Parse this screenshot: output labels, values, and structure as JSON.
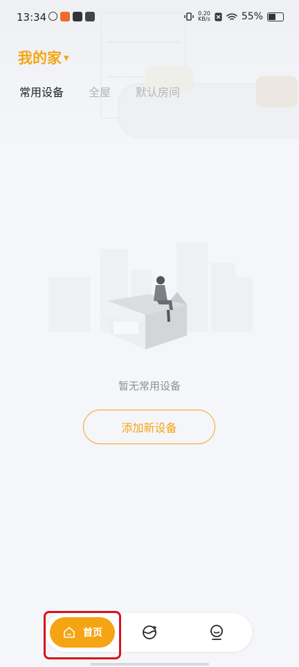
{
  "status_bar": {
    "time": "13:34",
    "net_speed": "0.20",
    "net_unit": "KB/s",
    "battery": "55%"
  },
  "header": {
    "home_name": "我的家"
  },
  "tabs": [
    {
      "label": "常用设备",
      "active": true
    },
    {
      "label": "全屋",
      "active": false
    },
    {
      "label": "默认房间",
      "active": false
    }
  ],
  "empty_state": {
    "message": "暂无常用设备",
    "add_button": "添加新设备"
  },
  "bottom_nav": {
    "home_label": "首页",
    "accent_color": "#f5a414"
  },
  "icons": [
    "home-icon",
    "scene-icon",
    "profile-icon",
    "wifi-icon",
    "battery-icon",
    "vibrate-icon"
  ]
}
